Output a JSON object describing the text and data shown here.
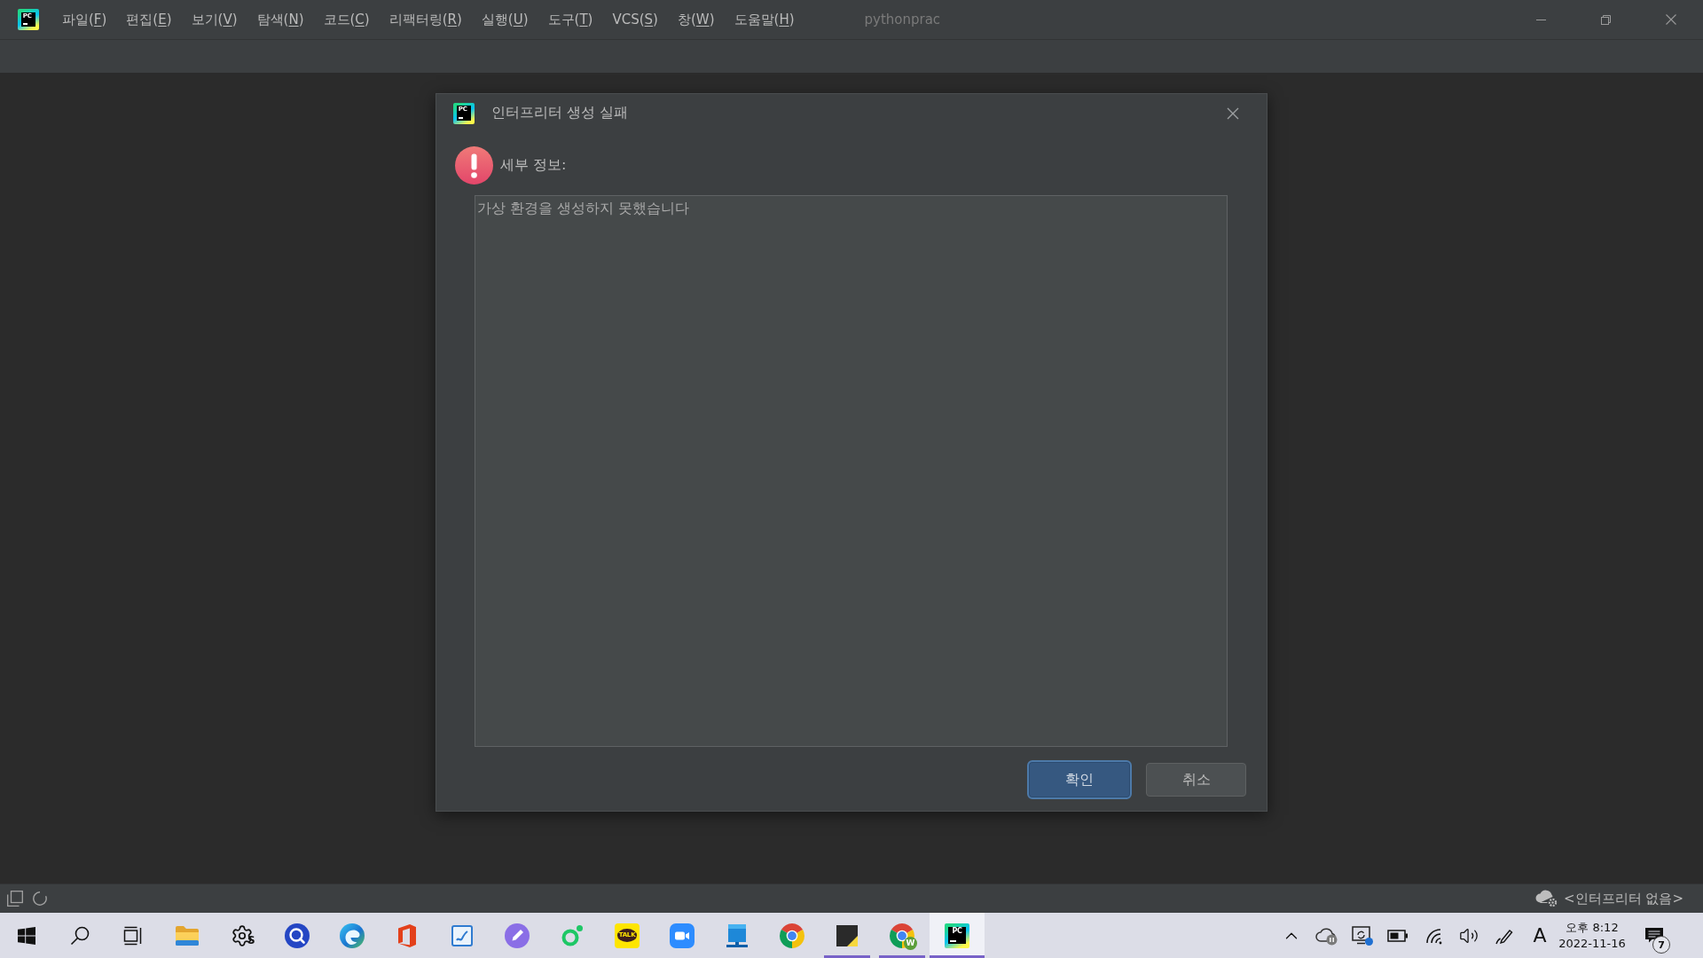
{
  "window": {
    "logo_text": "PC",
    "title": "pythonprac"
  },
  "menu": [
    "파일(F)",
    "편집(E)",
    "보기(V)",
    "탐색(N)",
    "코드(C)",
    "리팩터링(R)",
    "실행(U)",
    "도구(T)",
    "VCS(S)",
    "창(W)",
    "도움말(H)"
  ],
  "dialog": {
    "logo_text": "PC",
    "title": "인터프리터 생성 실패",
    "details_label": "세부 정보:",
    "details_text": "가상 환경을 생성하지 못했습니다",
    "buttons": [
      {
        "label": "확인",
        "default": true
      },
      {
        "label": "취소",
        "default": false
      }
    ]
  },
  "status_bar": {
    "interpreter": "<인터프리터 없음>"
  },
  "taskbar": {
    "apps": [
      {
        "kind": "start",
        "running": false,
        "selected": false
      },
      {
        "kind": "search",
        "running": false,
        "selected": false
      },
      {
        "kind": "taskview",
        "running": false,
        "selected": false
      },
      {
        "kind": "folder",
        "running": false,
        "selected": false
      },
      {
        "kind": "gear",
        "badge": "S",
        "running": false,
        "selected": false
      },
      {
        "kind": "magnifier",
        "running": false,
        "selected": false
      },
      {
        "kind": "wave",
        "running": false,
        "selected": false
      },
      {
        "kind": "office",
        "running": false,
        "selected": false
      },
      {
        "kind": "notepad",
        "running": false,
        "selected": false
      },
      {
        "kind": "pencil",
        "running": false,
        "selected": false
      },
      {
        "kind": "ring",
        "running": false,
        "selected": false
      },
      {
        "kind": "chat",
        "label": "TALK",
        "running": false,
        "selected": false
      },
      {
        "kind": "camera",
        "running": false,
        "selected": false
      },
      {
        "kind": "monitor",
        "running": false,
        "selected": false
      },
      {
        "kind": "chrome",
        "running": false,
        "selected": false
      },
      {
        "kind": "sticky",
        "running": true,
        "selected": false
      },
      {
        "kind": "chrome",
        "badge": "W",
        "running": true,
        "selected": false
      },
      {
        "kind": "ide",
        "label": "PC",
        "running": true,
        "selected": true
      }
    ],
    "tray": [
      {
        "kind": "chevron"
      },
      {
        "kind": "cloud"
      },
      {
        "kind": "display"
      },
      {
        "kind": "battery"
      },
      {
        "kind": "wifi"
      },
      {
        "kind": "volume"
      },
      {
        "kind": "pen"
      }
    ],
    "input_mode": "A",
    "clock": {
      "time": "오후 8:12",
      "date": "2022-11-16"
    },
    "notification_count": "7"
  }
}
